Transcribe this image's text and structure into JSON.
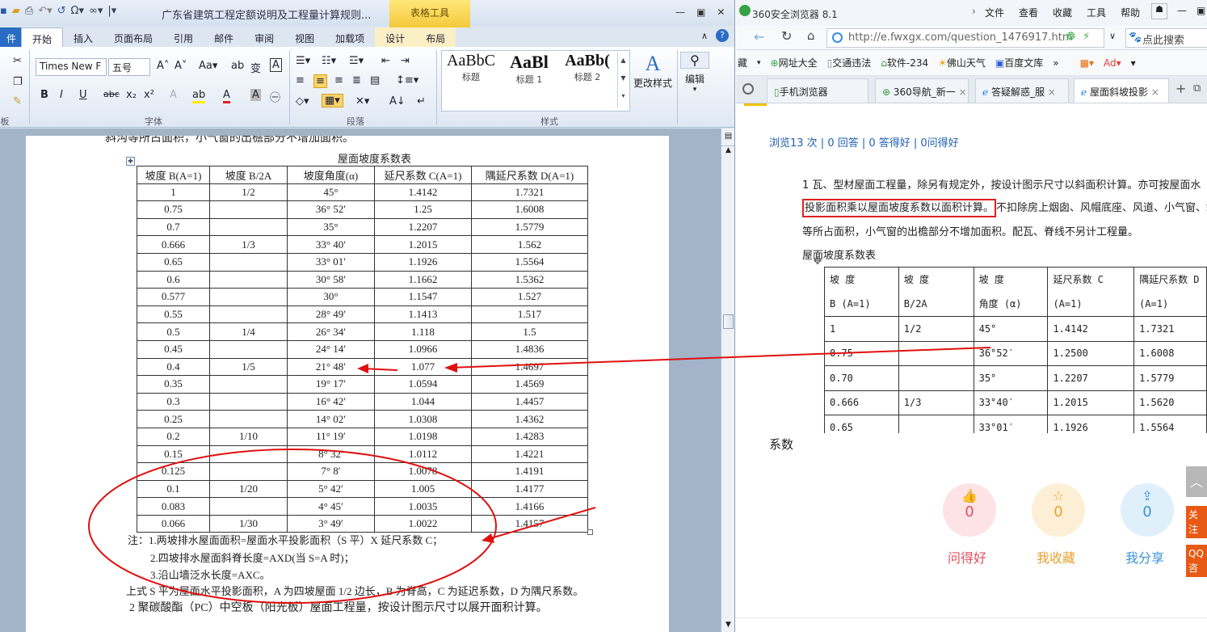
{
  "word": {
    "title": "广东省建筑工程定额说明及工程量计算规则...",
    "context_tab_group": "表格工具",
    "tabs": {
      "file": "件",
      "home": "开始",
      "insert": "插入",
      "layout": "页面布局",
      "references": "引用",
      "mailings": "邮件",
      "review": "审阅",
      "view": "视图",
      "addins": "加载项",
      "design": "设计",
      "tlayout": "布局"
    },
    "font_name": "Times New F",
    "font_size": "五号",
    "groups": {
      "clipboard": "板",
      "font": "字体",
      "paragraph": "段落",
      "styles": "样式"
    },
    "styles": [
      {
        "preview": "AaBbC",
        "label": "标题"
      },
      {
        "preview": "AaBl",
        "label": "标题 1"
      },
      {
        "preview": "AaBb(",
        "label": "标题 2"
      }
    ],
    "change_styles": "更改样式",
    "edit": "编辑",
    "doc": {
      "top_cut_line": "斜沟等所占面积，小气窗的出檐部分不增加面积。",
      "table_title": "屋面坡度系数表",
      "headers": [
        "坡度 B(A=1)",
        "坡度   B/2A",
        "坡度角度(α)",
        "延尺系数 C(A=1)",
        "隅延尺系数 D(A=1)"
      ],
      "rows": [
        [
          "1",
          "1/2",
          "45°",
          "1.4142",
          "1.7321"
        ],
        [
          "0.75",
          "",
          "36° 52′",
          "1.25",
          "1.6008"
        ],
        [
          "0.7",
          "",
          "35°",
          "1.2207",
          "1.5779"
        ],
        [
          "0.666",
          "1/3",
          "33° 40′",
          "1.2015",
          "1.562"
        ],
        [
          "0.65",
          "",
          "33° 01′",
          "1.1926",
          "1.5564"
        ],
        [
          "0.6",
          "",
          "30° 58′",
          "1.1662",
          "1.5362"
        ],
        [
          "0.577",
          "",
          "30°",
          "1.1547",
          "1.527"
        ],
        [
          "0.55",
          "",
          "28° 49′",
          "1.1413",
          "1.517"
        ],
        [
          "0.5",
          "1/4",
          "26° 34′",
          "1.118",
          "1.5"
        ],
        [
          "0.45",
          "",
          "24° 14′",
          "1.0966",
          "1.4836"
        ],
        [
          "0.4",
          "1/5",
          "21° 48′",
          "1.077",
          "1.4697"
        ],
        [
          "0.35",
          "",
          "19° 17′",
          "1.0594",
          "1.4569"
        ],
        [
          "0.3",
          "",
          "16° 42′",
          "1.044",
          "1.4457"
        ],
        [
          "0.25",
          "",
          "14° 02′",
          "1.0308",
          "1.4362"
        ],
        [
          "0.2",
          "1/10",
          "11° 19′",
          "1.0198",
          "1.4283"
        ],
        [
          "0.15",
          "",
          "8° 32′",
          "1.0112",
          "1.4221"
        ],
        [
          "0.125",
          "",
          "7° 8′",
          "1.0078",
          "1.4191"
        ],
        [
          "0.1",
          "1/20",
          "5° 42′",
          "1.005",
          "1.4177"
        ],
        [
          "0.083",
          "",
          "4° 45′",
          "1.0035",
          "1.4166"
        ],
        [
          "0.066",
          "1/30",
          "3° 49′",
          "1.0022",
          "1.4157"
        ]
      ],
      "note1": "注：1.两坡排水屋面面积=屋面水平投影面积（S 平）X 延尺系数 C；",
      "note2": "2.四坡排水屋面斜脊长度=AXD(当 S=A 时)；",
      "note3": "3.沿山墙泛水长度=AXC。",
      "para1": "上式 S 平为屋面水平投影面积，A 为四坡屋面 1/2 边长，B 为脊高，C 为延迟系数，D 为隅尺系数。",
      "para2": "2 聚碳酸酯（PC）中空板（阳光板）屋面工程量，按设计图示尺寸以展开面积计算。"
    }
  },
  "browser": {
    "title": "360安全浏览器 8.1",
    "menu": [
      "文件",
      "查看",
      "收藏",
      "工具",
      "帮助"
    ],
    "url": "http://e.fwxgx.com/question_1476917.htm",
    "search_placeholder": "点此搜索",
    "favs": [
      "藏",
      "网址大全",
      "交通违法",
      "软件-234",
      "佛山天气",
      "百度文库"
    ],
    "tabs": [
      "手机浏览器",
      "360导航_新一",
      "答疑解惑_服",
      "屋面斜坡投影"
    ],
    "stats": "浏览13 次 | 0 回答 | 0 答得好 | 0问得好",
    "p1_line1": "1    瓦、型材屋面工程量，除另有规定外，按设计图示尺寸以斜面积计算。亦可按屋面水",
    "p1_highlight": "投影面积乘以屋面坡度系数以面积计算。",
    "p1_line2_rest": "不扣除房上烟囱、风帽底座、风道、小气窗、斜",
    "p1_line3": "等所占面积，小气窗的出檐部分不增加面积。配瓦、脊线不另计工程量。",
    "table_title": "屋面坡度系数表",
    "headers_top": [
      "坡 度",
      "坡   度",
      "坡   度",
      "延尺系数 C",
      "隅延尺系数 D"
    ],
    "headers_bottom": [
      "B (A=1)",
      "B/2A",
      "角度 (α)",
      "(A=1)",
      "(A=1)"
    ],
    "rows": [
      [
        "1",
        "1/2",
        "45°",
        "1.4142",
        "1.7321"
      ],
      [
        "0.75",
        "",
        "36°52′",
        "1.2500",
        "1.6008"
      ],
      [
        "0.70",
        "",
        "35°",
        "1.2207",
        "1.5779"
      ],
      [
        "0.666",
        "1/3",
        "33°40′",
        "1.2015",
        "1.5620"
      ],
      [
        "0.65",
        "",
        "33°01′",
        "1.1926",
        "1.5564"
      ]
    ],
    "answer_word": "系数",
    "actions": [
      {
        "count": "0",
        "label": "问得好"
      },
      {
        "count": "0",
        "label": "我收藏"
      },
      {
        "count": "0",
        "label": "我分享"
      }
    ],
    "side_buttons": [
      "关注我们",
      "QQ咨询"
    ]
  }
}
